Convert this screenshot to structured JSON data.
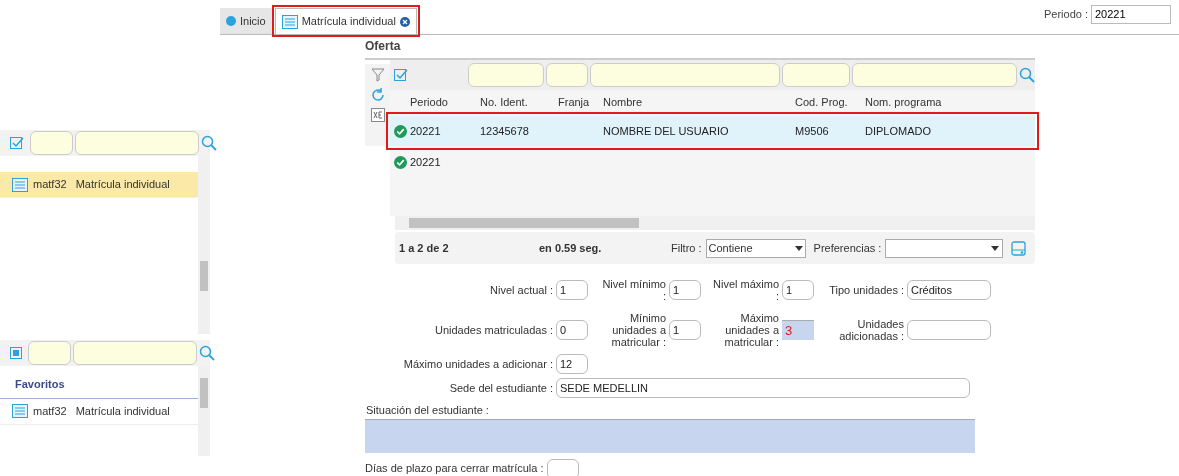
{
  "sidebar": {
    "menu_list": {
      "items": [
        {
          "code": "matf32",
          "label": "Matrícula individual",
          "selected": true
        }
      ]
    },
    "favorites": {
      "title": "Favoritos",
      "items": [
        {
          "code": "matf32",
          "label": "Matrícula individual",
          "selected": false
        }
      ]
    }
  },
  "tabs": [
    {
      "label": "Inicio",
      "kind": "home",
      "selected": false,
      "highlighted": false
    },
    {
      "label": "Matrícula individual",
      "kind": "form",
      "selected": true,
      "highlighted": true
    }
  ],
  "periodo": {
    "label": "Periodo :",
    "value": "20221"
  },
  "oferta": {
    "title": "Oferta",
    "table": {
      "columns": [
        "Periodo",
        "No. Ident.",
        "Franja",
        "Nombre",
        "Cod. Prog.",
        "Nom. programa"
      ],
      "rows": [
        {
          "cells": [
            "20221",
            "12345678",
            "",
            "NOMBRE DEL USUARIO",
            "M9506",
            "DIPLOMADO"
          ],
          "selected": true,
          "highlighted": true
        },
        {
          "cells": [
            "20221",
            "",
            "",
            "",
            "",
            ""
          ],
          "selected": false,
          "highlighted": false
        }
      ]
    },
    "footer": {
      "count": "1 a 2 de 2",
      "time": "en 0.59 seg.",
      "filter_label": "Filtro :",
      "filter_value": "Contiene",
      "prefs_label": "Preferencias :"
    }
  },
  "form": {
    "row1": [
      {
        "label": "Nivel actual :",
        "value": "1"
      },
      {
        "label": "Nivel mínimo :",
        "value": "1"
      },
      {
        "label": "Nivel máximo :",
        "value": "1"
      },
      {
        "label": "Tipo unidades :",
        "value": "Créditos"
      }
    ],
    "row2": [
      {
        "label": "Unidades matriculadas :",
        "value": "0",
        "emphasized": false
      },
      {
        "label": "Mínimo unidades a matricular :",
        "value": "1",
        "emphasized": false
      },
      {
        "label": "Máximo unidades a matricular :",
        "value": "3",
        "emphasized": true
      },
      {
        "label": "Unidades adicionadas :",
        "emphasized": false
      }
    ],
    "max_add": {
      "label": "Máximo unidades a adicionar :",
      "value": "12"
    },
    "sede": {
      "label": "Sede del estudiante :",
      "value": "SEDE MEDELLIN"
    },
    "situacion": {
      "label": "Situación del estudiante :"
    },
    "dias": {
      "label": "Días de plazo para cerrar matrícula :"
    }
  }
}
